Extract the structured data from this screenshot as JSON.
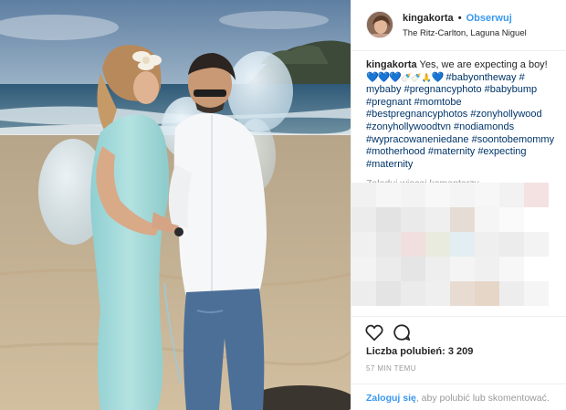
{
  "post": {
    "username": "kingakorta",
    "follow_label": "Obserwuj",
    "separator": "•",
    "location": "The Ritz-Carlton, Laguna Niguel"
  },
  "caption": {
    "username": "kingakorta",
    "text": "Yes, we are expecting a boy!",
    "hearts": "💙💙💙",
    "emoji_extra": "🍼🍼🙏",
    "heart_last": "💙",
    "tags": [
      "#babyontheway",
      "#",
      "mybaby",
      "#pregnancyphoto",
      "#babybump",
      "#pregnant",
      "#momtobe",
      "#bestpregnancyphotos",
      "#zonyhollywood",
      "#zonyhollywoodtvn",
      "#nodiamonds",
      "#wypracowaneniedane",
      "#soontobemommy",
      "#motherhood",
      "#maternity",
      "#expecting",
      "#maternity"
    ]
  },
  "comments": {
    "load_more": "Załaduj więcej komentarzy"
  },
  "actions": {
    "like_icon": "heart-icon",
    "comment_icon": "comment-icon",
    "likes_label": "Liczba polubień: 3 209",
    "time_label": "57 MIN TEMU"
  },
  "footer": {
    "login_link": "Zaloguj się",
    "login_rest": ", aby polubić lub skomentować."
  },
  "colors": {
    "link": "#3897f0",
    "hashtag": "#003569",
    "muted": "#999999",
    "dress": "#a9dcdc",
    "sand": "#c9b496",
    "sea": "#3f6b86"
  }
}
